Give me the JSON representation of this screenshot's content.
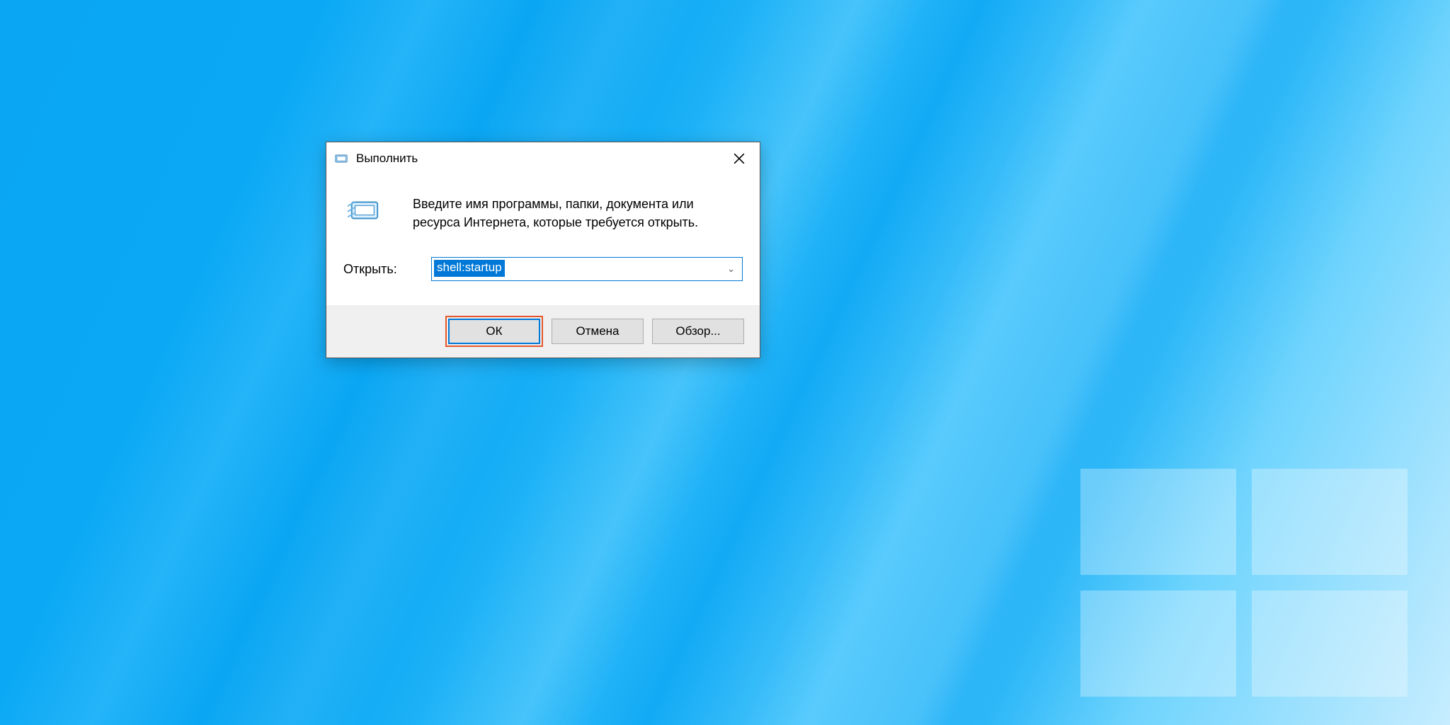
{
  "dialog": {
    "title": "Выполнить",
    "description": "Введите имя программы, папки, документа или ресурса Интернета, которые требуется открыть.",
    "open_label": "Открыть:",
    "open_value": "shell:startup",
    "buttons": {
      "ok": "ОК",
      "cancel": "Отмена",
      "browse": "Обзор..."
    }
  },
  "icons": {
    "title_icon": "run-icon",
    "body_icon": "run-icon",
    "close": "close-icon",
    "dropdown": "chevron-down-icon"
  },
  "colors": {
    "accent": "#0078d7",
    "highlight_frame": "#e4572e",
    "button_face": "#e1e1e1",
    "button_border": "#adadad",
    "panel": "#f0f0f0"
  }
}
